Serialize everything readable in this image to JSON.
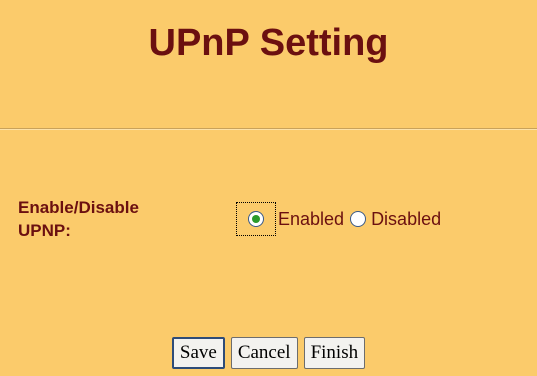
{
  "page": {
    "title": "UPnP Setting"
  },
  "form": {
    "label_line1": "Enable/Disable",
    "label_line2": "UPNP:",
    "options": [
      {
        "label": "Enabled",
        "checked": true
      },
      {
        "label": "Disabled",
        "checked": false
      }
    ]
  },
  "buttons": {
    "save": "Save",
    "cancel": "Cancel",
    "finish": "Finish"
  },
  "colors": {
    "background": "#fbcb6b",
    "text": "#6b1010",
    "radio_checked": "#2b9a2b"
  }
}
